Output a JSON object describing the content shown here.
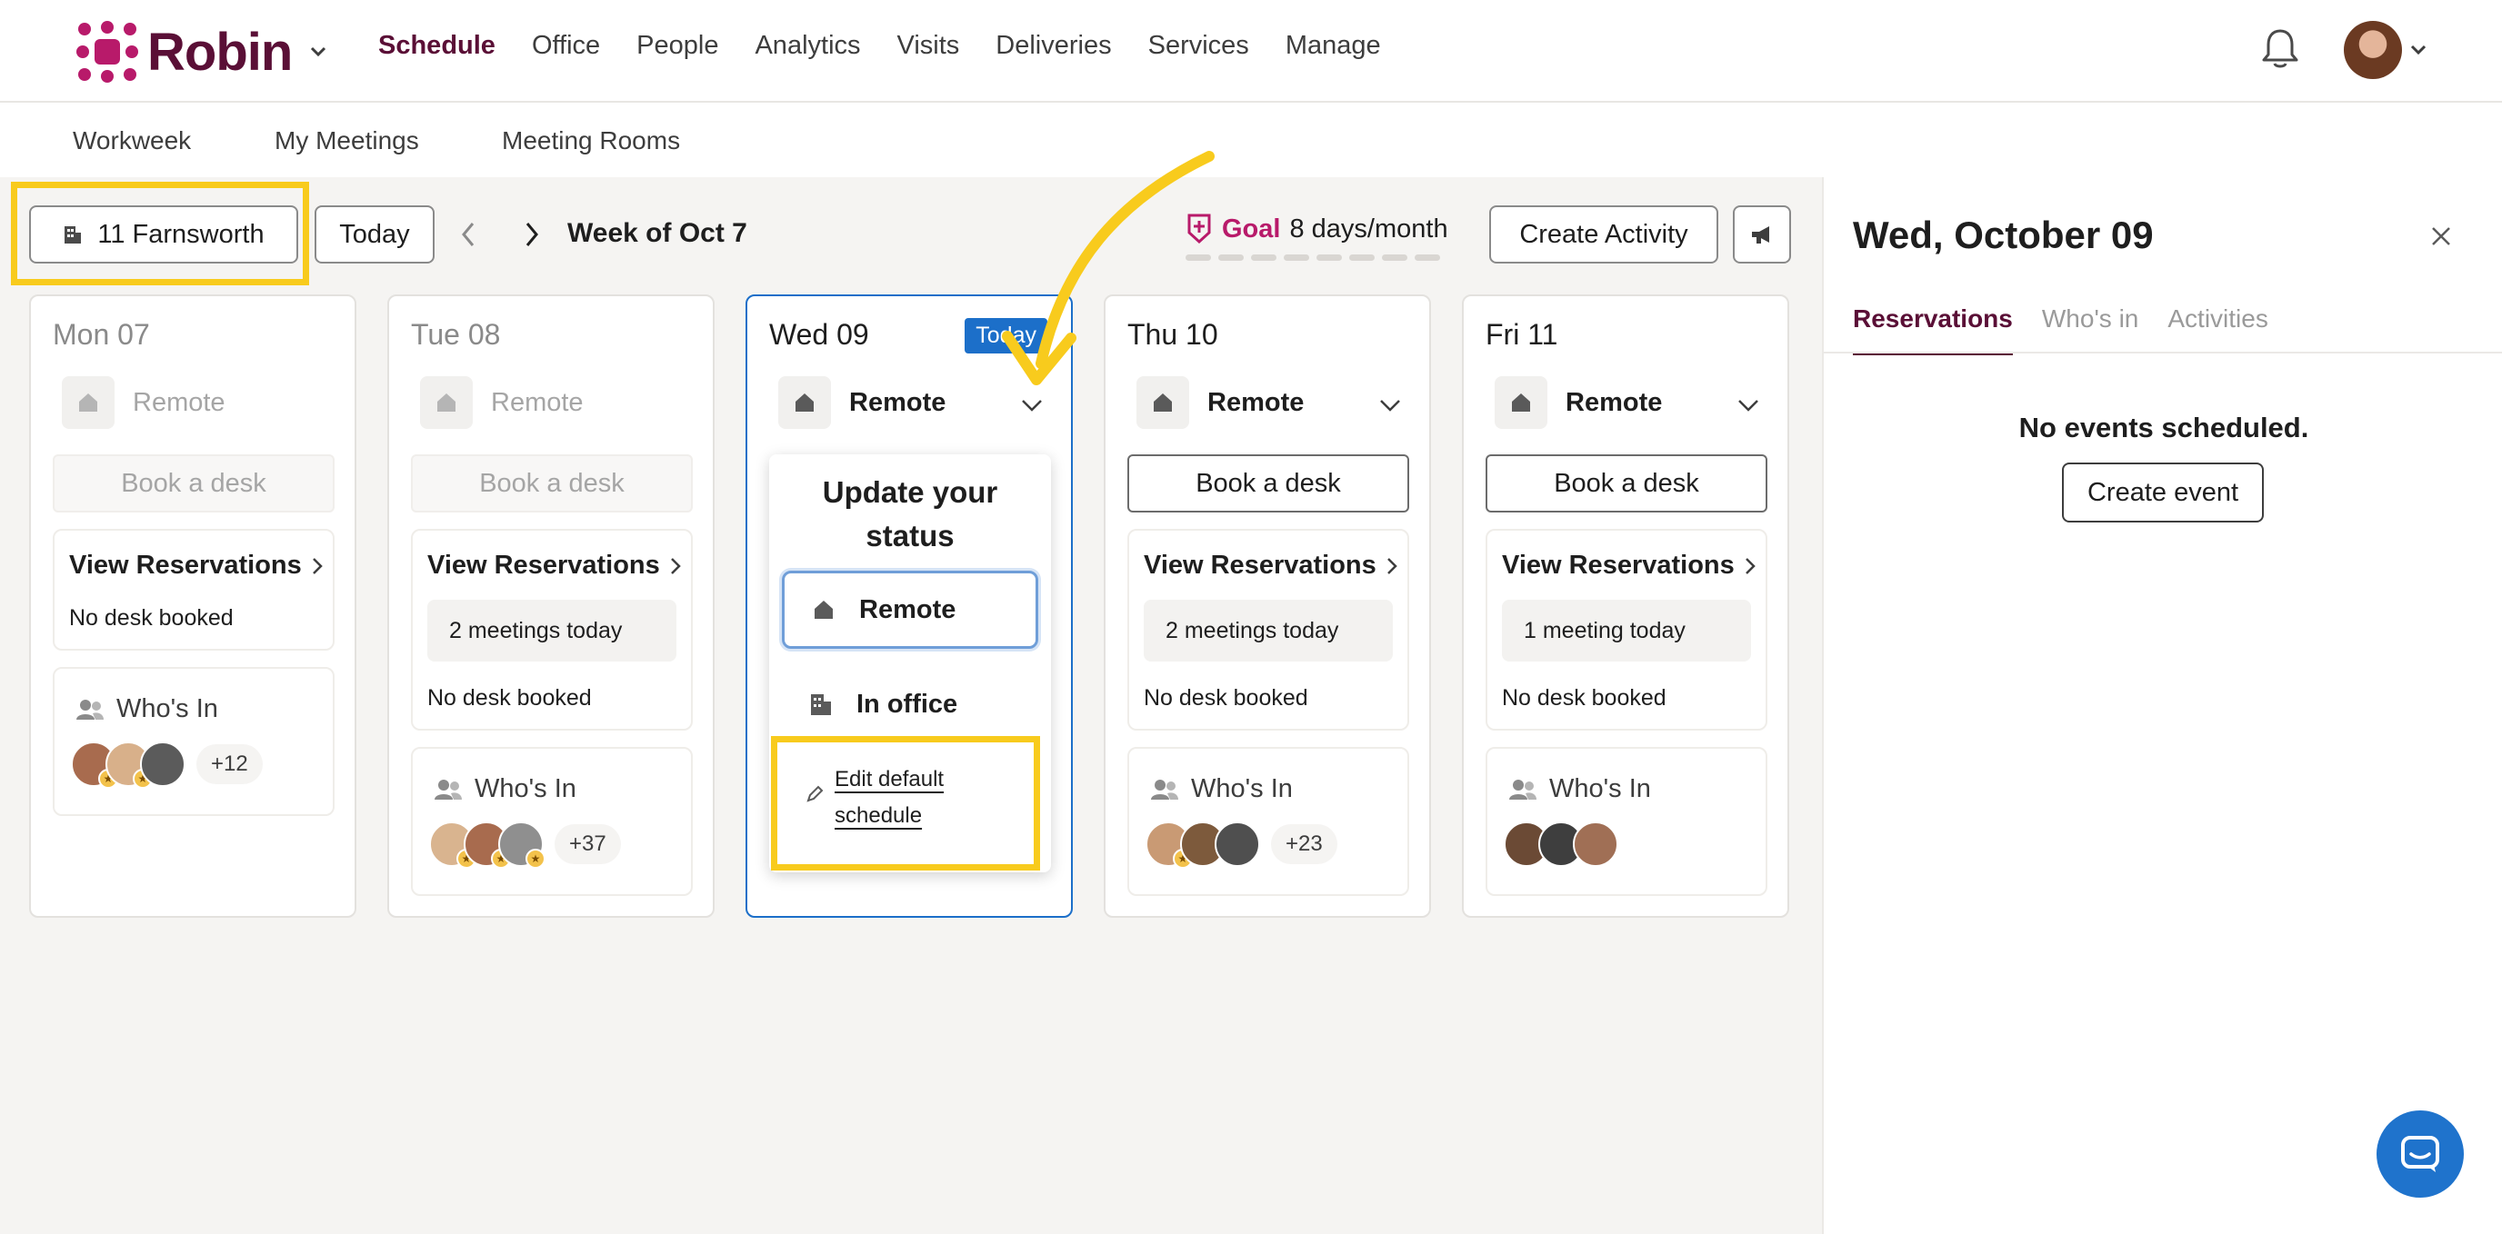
{
  "app": {
    "brand": "Robin",
    "brand_color": "#b81a6a",
    "accent_color": "#5a0f36"
  },
  "nav": {
    "items": [
      "Schedule",
      "Office",
      "People",
      "Analytics",
      "Visits",
      "Deliveries",
      "Services",
      "Manage"
    ],
    "active": "Schedule"
  },
  "subnav": {
    "items": [
      "Workweek",
      "My Meetings",
      "Meeting Rooms"
    ]
  },
  "toolbar": {
    "location": "11 Farnsworth",
    "today_label": "Today",
    "week_label": "Week of Oct 7",
    "goal_label": "Goal",
    "goal_value": "8 days/month",
    "create_activity": "Create Activity"
  },
  "days": [
    {
      "title": "Mon 07",
      "status": "Remote",
      "book": "Book a desk",
      "view_reservations": "View Reservations",
      "meetings": "",
      "desk": "No desk booked",
      "whos_in": "Who's In",
      "more": "+12"
    },
    {
      "title": "Tue 08",
      "status": "Remote",
      "book": "Book a desk",
      "view_reservations": "View Reservations",
      "meetings": "2 meetings today",
      "desk": "No desk booked",
      "whos_in": "Who's In",
      "more": "+37"
    },
    {
      "title": "Wed 09",
      "badge": "Today",
      "status": "Remote"
    },
    {
      "title": "Thu 10",
      "status": "Remote",
      "book": "Book a desk",
      "view_reservations": "View Reservations",
      "meetings": "2 meetings today",
      "desk": "No desk booked",
      "whos_in": "Who's In",
      "more": "+23"
    },
    {
      "title": "Fri 11",
      "status": "Remote",
      "book": "Book a desk",
      "view_reservations": "View Reservations",
      "meetings": "1 meeting today",
      "desk": "No desk booked",
      "whos_in": "Who's In",
      "more": ""
    }
  ],
  "status_menu": {
    "title_line1": "Update your",
    "title_line2": "status",
    "options": [
      "Remote",
      "In office"
    ],
    "selected": "Remote",
    "edit_line1": "Edit default",
    "edit_line2": "schedule"
  },
  "panel": {
    "title": "Wed, October 09",
    "tabs": [
      "Reservations",
      "Who's in",
      "Activities"
    ],
    "active_tab": "Reservations",
    "empty_text": "No events scheduled.",
    "create_event": "Create event"
  },
  "annotation_color": "#f8cb1d"
}
